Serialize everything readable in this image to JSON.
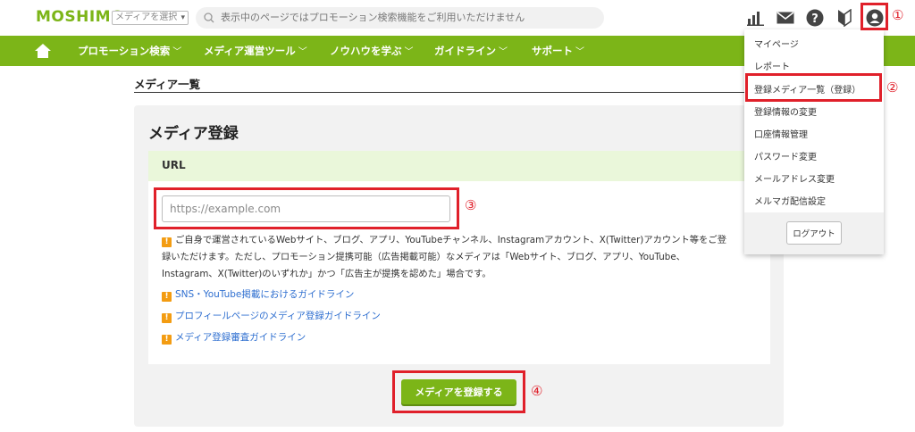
{
  "header": {
    "logo_text": "MOSHIMO",
    "media_select": "メディアを選択",
    "search_text": "表示中のページではプロモーション検索機能をご利用いただけません",
    "icons": [
      "bar-chart-icon",
      "mail-icon",
      "help-icon",
      "beginner-mark-icon",
      "user-icon"
    ]
  },
  "nav": {
    "items": [
      {
        "label": "プロモーション検索"
      },
      {
        "label": "メディア運営ツール"
      },
      {
        "label": "ノウハウを学ぶ"
      },
      {
        "label": "ガイドライン"
      },
      {
        "label": "サポート"
      }
    ],
    "chevron": "﹀"
  },
  "page": {
    "heading": "メディア一覧"
  },
  "card": {
    "title": "メディア登録",
    "url_label": "URL",
    "url_placeholder": "https://example.com",
    "note_line1": "ご自身で運営されているWebサイト、ブログ、アプリ、YouTubeチャンネル、Instagramアカウント、X(Twitter)アカウント等をご登",
    "note_line2": "録いただけます。ただし、プロモーション提携可能（広告掲載可能）なメディアは「Webサイト、ブログ、アプリ、YouTube、",
    "note_line3": "Instagram、X(Twitter)のいずれか」かつ「広告主が提携を認めた」場合です。",
    "links": [
      {
        "label": "SNS・YouTube掲載におけるガイドライン"
      },
      {
        "label": "プロフィールページのメディア登録ガイドライン"
      },
      {
        "label": "メディア登録審査ガイドライン"
      }
    ],
    "submit_label": "メディアを登録する"
  },
  "dropdown": {
    "items": [
      {
        "label": "マイページ"
      },
      {
        "label": "レポート"
      },
      {
        "label": "登録メディア一覧（登録）"
      },
      {
        "label": "登録情報の変更"
      },
      {
        "label": "口座情報管理"
      },
      {
        "label": "パスワード変更"
      },
      {
        "label": "メールアドレス変更"
      },
      {
        "label": "メルマガ配信設定"
      }
    ],
    "logout_label": "ログアウト"
  },
  "annotations": {
    "n1": "①",
    "n2": "②",
    "n3": "③",
    "n4": "④",
    "color": "#e0202a"
  },
  "colors": {
    "brand_green": "#7cb518",
    "link_blue": "#2f6fd0",
    "url_band": "#eaf7da",
    "warning_orange": "#f39c12"
  }
}
